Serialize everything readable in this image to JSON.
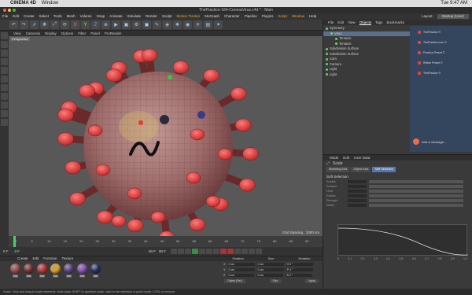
{
  "mac": {
    "app": "CINEMA 4D",
    "window_menu": "Window",
    "clock": "Tue 9:47 AM"
  },
  "window": {
    "title": "ThePractice-184-CoronaVirus.c4d * - Main"
  },
  "menubar": {
    "items": [
      "File",
      "Edit",
      "Create",
      "Select",
      "Tools",
      "Mesh",
      "Volume",
      "Snap",
      "Animate",
      "Simulate",
      "Render",
      "Sculpt",
      "Motion Tracker",
      "MoGraph",
      "Character",
      "Pipeline",
      "Plugins",
      "Script",
      "Window",
      "Help"
    ],
    "highlighted": [
      "Motion Tracker",
      "Script",
      "Window"
    ],
    "layout_label": "Layout:",
    "layout_value": "Startup (User)"
  },
  "viewport": {
    "menu": [
      "View",
      "Cameras",
      "Display",
      "Options",
      "Filter",
      "Panel",
      "ProRender"
    ],
    "camera_tag": "Perspective",
    "grid_spacing": "Grid Spacing : 1000 cm"
  },
  "timeline": {
    "ticks": [
      "0",
      "5",
      "10",
      "15",
      "20",
      "25",
      "30",
      "35",
      "40",
      "45",
      "50",
      "55",
      "60",
      "65",
      "70",
      "75",
      "80",
      "85",
      "90"
    ],
    "current_frame": "0 F",
    "start": "0 F",
    "end": "90 F",
    "end_right": "90 F"
  },
  "materials": {
    "tabs": [
      "Create",
      "Edit",
      "Function",
      "Texture"
    ],
    "items": [
      {
        "label": "Mat",
        "color": "#9a4a4a"
      },
      {
        "label": "Mat",
        "color": "#7a2f2f"
      },
      {
        "label": "Mat",
        "color": "#c23434"
      },
      {
        "label": "Mat",
        "color": "#e0a020"
      },
      {
        "label": "Mat",
        "color": "#5b3f8a"
      },
      {
        "label": "Mat",
        "color": "#8b4dbd"
      },
      {
        "label": "Mat",
        "color": "#223066"
      }
    ]
  },
  "coords": {
    "headers": [
      "Position",
      "Size",
      "Rotation"
    ],
    "rows": [
      {
        "axis": "X",
        "pos": "0 cm",
        "size": "0 cm",
        "rot": "H 0 °"
      },
      {
        "axis": "Y",
        "pos": "0 cm",
        "size": "0 cm",
        "rot": "P 0 °"
      },
      {
        "axis": "Z",
        "pos": "0 cm",
        "size": "0 cm",
        "rot": "B 0 °"
      }
    ],
    "mode": "Object (Rel)",
    "size_mode": "Size",
    "apply": "Apply"
  },
  "status": "Scale: Click and drag to scale elements. Hold down SHIFT to quantize scale / add to the selection in point mode, CTRL to remove.",
  "objects": {
    "tabs": [
      "File",
      "Edit",
      "View",
      "Objects",
      "Tags",
      "Bookmarks"
    ],
    "active_tab": "Objects",
    "rows": [
      {
        "label": "Symmetry",
        "indent": 0,
        "selected": false
      },
      {
        "label": "Virus",
        "indent": 1,
        "selected": true
      },
      {
        "label": "Tentacle",
        "indent": 2,
        "selected": false
      },
      {
        "label": "Tentacle",
        "indent": 2,
        "selected": false
      },
      {
        "label": "Subdivision Surface",
        "indent": 0,
        "selected": false
      },
      {
        "label": "Subdivision Surface",
        "indent": 0,
        "selected": false
      },
      {
        "label": "Cam",
        "indent": 0,
        "selected": false
      },
      {
        "label": "Camera",
        "indent": 0,
        "selected": false
      },
      {
        "label": "Light",
        "indent": 0,
        "selected": false
      },
      {
        "label": "Light",
        "indent": 0,
        "selected": false
      }
    ],
    "notes": [
      "ThePractice ©",
      "ThePractice.com ©",
      "Practice Preset ©",
      "Refine Preset ©",
      "ThePractice ©"
    ],
    "bottom_note": "Add a message..."
  },
  "attributes": {
    "tabs": [
      "Mode",
      "Edit",
      "User Data"
    ],
    "header": "Scale",
    "subtabs": [
      "Modeling Axis",
      "Object Axis",
      "Soft Selection"
    ],
    "active_subtab": "Soft Selection",
    "section": "Soft Selection",
    "rows": [
      "Enable",
      "Surface",
      "Limit",
      "Radius",
      "Strength",
      "Width"
    ],
    "graph_ticks": [
      "0",
      "0.1",
      "0.2",
      "0.3",
      "0.4",
      "0.5",
      "0.6",
      "0.7",
      "0.8",
      "0.9",
      "1.0"
    ]
  },
  "colors": {
    "accent_orange": "#f5a623",
    "selection_blue": "#5a6f8e",
    "play_green": "#4fcf6b"
  }
}
